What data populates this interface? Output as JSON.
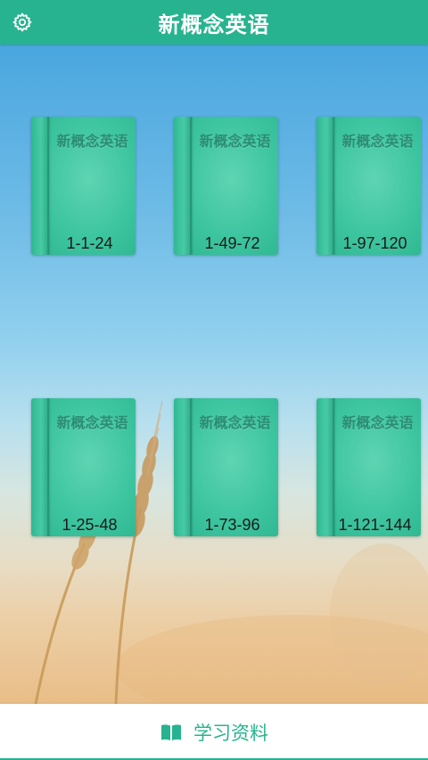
{
  "header": {
    "title": "新概念英语",
    "settings_icon": "gear-icon"
  },
  "books": [
    {
      "title": "新概念英语",
      "range": "1-1-24"
    },
    {
      "title": "新概念英语",
      "range": "1-49-72"
    },
    {
      "title": "新概念英语",
      "range": "1-97-120"
    },
    {
      "title": "新概念英语",
      "range": "1-25-48"
    },
    {
      "title": "新概念英语",
      "range": "1-73-96"
    },
    {
      "title": "新概念英语",
      "range": "1-121-144"
    }
  ],
  "footer": {
    "label": "学习资料",
    "icon": "open-book-icon"
  },
  "colors": {
    "accent": "#27b38f",
    "book": "#3dc5a0",
    "book_title": "#2a8d73"
  }
}
